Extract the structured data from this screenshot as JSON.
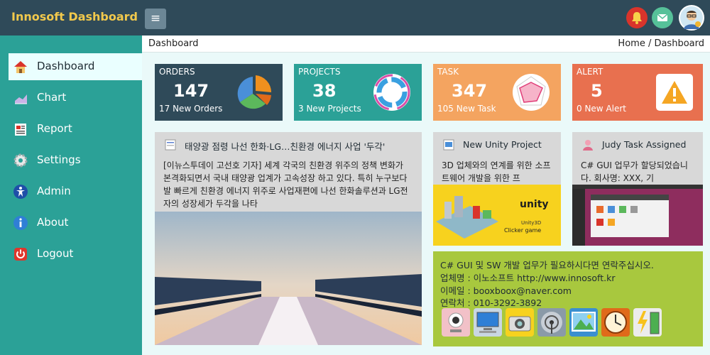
{
  "header": {
    "brand": "Innosoft Dashboard",
    "menu_glyph": "≡"
  },
  "sidebar": {
    "items": [
      {
        "label": "Dashboard"
      },
      {
        "label": "Chart"
      },
      {
        "label": "Report"
      },
      {
        "label": "Settings"
      },
      {
        "label": "Admin"
      },
      {
        "label": "About"
      },
      {
        "label": "Logout"
      }
    ]
  },
  "breadcrumb": {
    "title": "Dashboard",
    "path": "Home / Dashboard"
  },
  "stats": [
    {
      "label": "ORDERS",
      "value": "147",
      "sub": "17 New Orders",
      "color": "#2f4a59"
    },
    {
      "label": "PROJECTS",
      "value": "38",
      "sub": "3 New Projects",
      "color": "#2ba197"
    },
    {
      "label": "TASK",
      "value": "347",
      "sub": "105 New Task",
      "color": "#f4a460"
    },
    {
      "label": "ALERT",
      "value": "5",
      "sub": "0 New Alert",
      "color": "#e8704f"
    }
  ],
  "news": {
    "title": "태양광 점령 나선 한화·LG…친환경 에너지 사업 '두각'",
    "body": "[이뉴스투데이 고선호 기자] 세계 각국의 친환경 위주의 정책 변화가 본격화되면서 국내 태양광 업계가 고속성장 하고 있다. 특히 누구보다 발 빠르게 친환경 에너지 위주로 사업재편에 나선 한화솔루션과 LG전자의 성장세가 두각을 나타"
  },
  "unity": {
    "title": "New Unity Project",
    "body": "3D 업체와의 연계를 위한 소프트웨어 개발을 위한 프",
    "logo": "unity",
    "caption1": "Unity3D",
    "caption2": "Clicker game"
  },
  "judy": {
    "title": "Judy Task Assigned",
    "body": "C# GUI 업무가 할당되었습니다. 회사명: XXX, 기"
  },
  "contact": {
    "line1": "C# GUI 및 SW 개발 업무가 필요하시다면 연락주십시오.",
    "line2": "업체명 : 이노소프트 http://www.innosoft.kr",
    "line3": "이메일 : booxboox@naver.com",
    "line4": "연락처 : 010-3292-3892"
  }
}
